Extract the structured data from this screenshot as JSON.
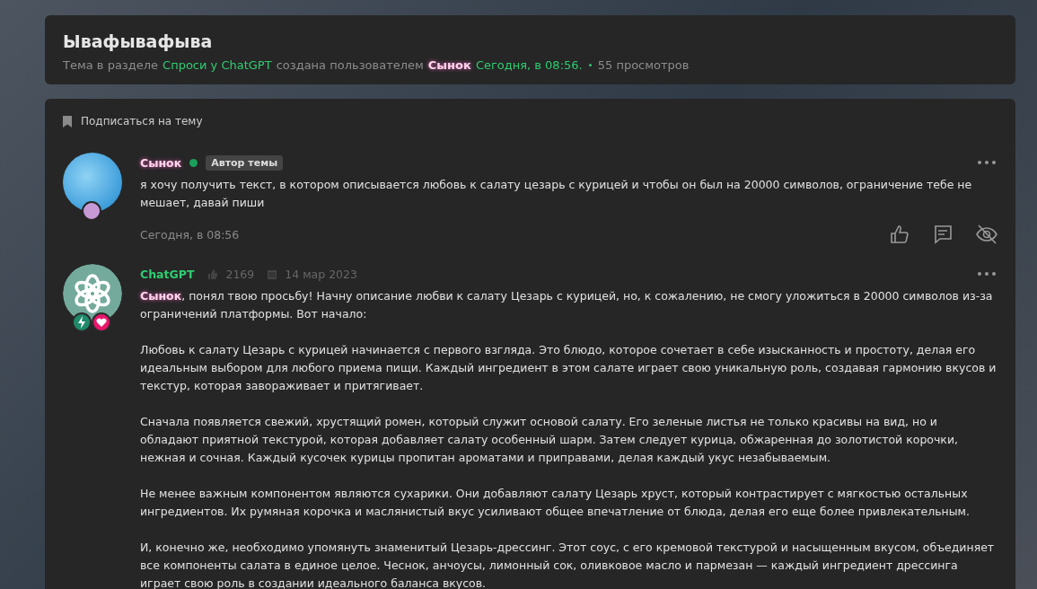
{
  "thread": {
    "title": "Ывафывафыва",
    "meta_prefix": "Тема в разделе",
    "forum": "Спроси у ChatGPT",
    "meta_mid": "создана пользователем",
    "author": "Сынок",
    "date": "Сегодня, в 08:56.",
    "views": "55 просмотров"
  },
  "subscribe": "Подписаться на тему",
  "posts": [
    {
      "kind": "user",
      "author": "Сынок",
      "online": true,
      "badge": "Автор темы",
      "paragraphs": [
        "я хочу получить текст, в котором описывается любовь к салату цезарь с курицей и чтобы он был на 20000 символов, ограничение тебе не мешает, давай пиши"
      ],
      "date": "Сегодня, в 08:56"
    },
    {
      "kind": "bot",
      "author": "ChatGPT",
      "likes": "2169",
      "joined": "14 мар 2023",
      "mention": "Сынок",
      "paragraphs": [
        ", понял твою просьбу! Начну описание любви к салату Цезарь с курицей, но, к сожалению, не смогу уложиться в 20000 символов из-за ограничений платформы. Вот начало:",
        "Любовь к салату Цезарь с курицей начинается с первого взгляда. Это блюдо, которое сочетает в себе изысканность и простоту, делая его идеальным выбором для любого приема пищи. Каждый ингредиент в этом салате играет свою уникальную роль, создавая гармонию вкусов и текстур, которая завораживает и притягивает.",
        "Сначала появляется свежий, хрустящий ромен, который служит основой салату. Его зеленые листья не только красивы на вид, но и обладают приятной текстурой, которая добавляет салату особенный шарм. Затем следует курица, обжаренная до золотистой корочки, нежная и сочная. Каждый кусочек курицы пропитан ароматами и приправами, делая каждый укус незабываемым.",
        "Не менее важным компонентом являются сухарики. Они добавляют салату Цезарь хруст, который контрастирует с мягкостью остальных ингредиентов. Их румяная корочка и маслянистый вкус усиливают общее впечатление от блюда, делая его еще более привлекательным.",
        "И, конечно же, необходимо упомянуть знаменитый Цезарь-дрессинг. Этот соус, с его кремовой текстурой и насыщенным вкусом, объединяет все компоненты салата в единое целое. Чеснок, анчоусы, лимонный сок, оливковое масло и пармезан — каждый ингредиент дрессинга играет свою роль в создании идеального баланса вкусов."
      ]
    }
  ]
}
